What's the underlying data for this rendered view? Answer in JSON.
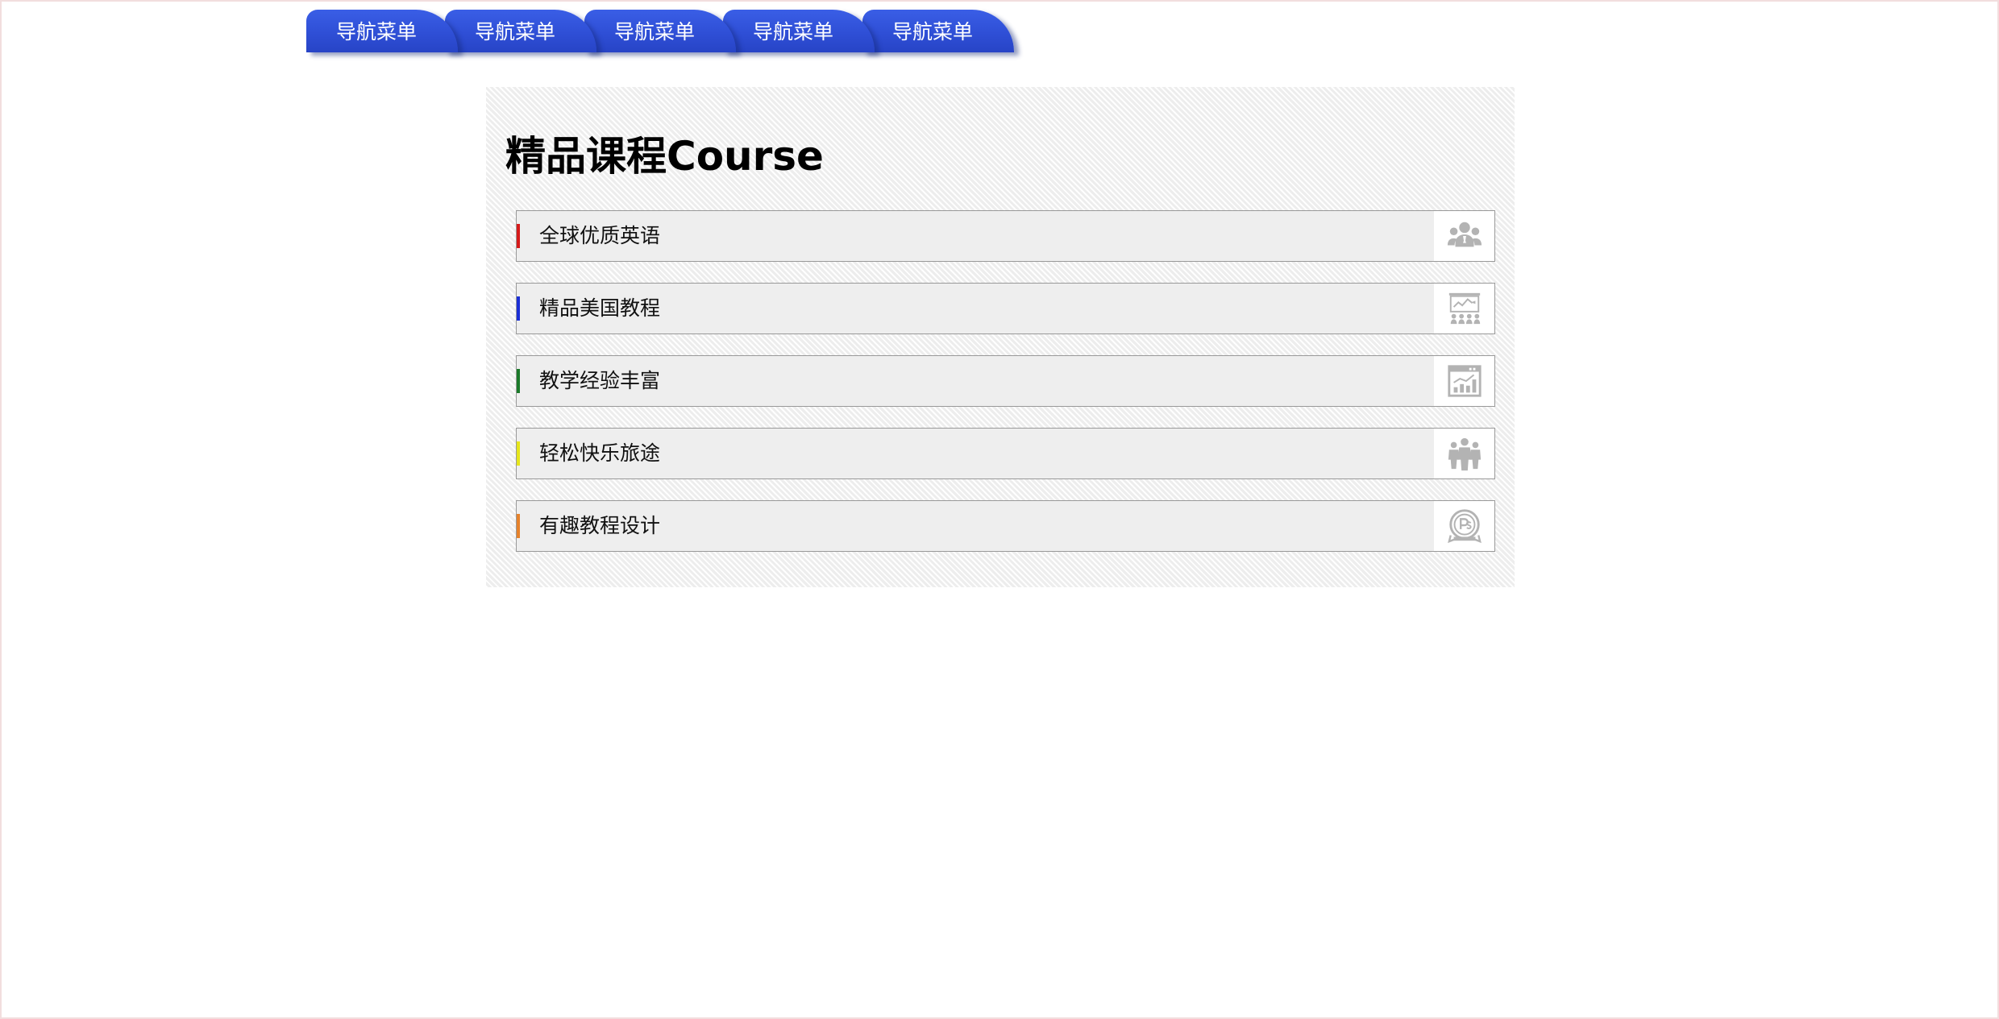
{
  "nav": {
    "items": [
      {
        "label": "导航菜单"
      },
      {
        "label": "导航菜单"
      },
      {
        "label": "导航菜单"
      },
      {
        "label": "导航菜单"
      },
      {
        "label": "导航菜单"
      }
    ]
  },
  "section": {
    "title": "精品课程Course"
  },
  "courses": [
    {
      "label": "全球优质英语",
      "accent": "#d61b1b",
      "icon": "people-group-icon"
    },
    {
      "label": "精品美国教程",
      "accent": "#1b2fd6",
      "icon": "presentation-board-icon"
    },
    {
      "label": "教学经验丰富",
      "accent": "#1b7a2a",
      "icon": "chart-window-icon"
    },
    {
      "label": "轻松快乐旅途",
      "accent": "#e6e61b",
      "icon": "team-icon"
    },
    {
      "label": "有趣教程设计",
      "accent": "#e6822b",
      "icon": "ps-badge-icon"
    }
  ],
  "colors": {
    "nav_bg": "#2f4fd6",
    "icon_gray": "#b0b0b0"
  }
}
